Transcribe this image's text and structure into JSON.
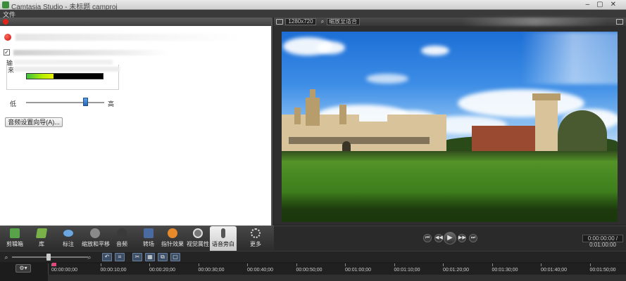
{
  "app": {
    "title": "Camtasia Studio - 未标题 camproj",
    "menu_file": "文件"
  },
  "voice_narration": {
    "input_label": "输",
    "source_label": "来",
    "low_label": "低",
    "high_label": "高",
    "checkbox_mark": "✓",
    "audio_setup_wizard": "音频设置向导(A)...",
    "input_level": 0.35,
    "volume_level": 0.76
  },
  "preview": {
    "resolution": "1280x720",
    "zoom": "缩放至适合",
    "zoom_icon": "magnifier-icon"
  },
  "player": {
    "timecode": "0:00:00:00 / 0:01:00:00"
  },
  "tasks": [
    {
      "label": "剪辑箱",
      "icon": "clip-bin-icon",
      "color": "#58a34a"
    },
    {
      "label": "库",
      "icon": "library-icon",
      "color": "#7ab24a"
    },
    {
      "label": "标注",
      "icon": "callout-icon",
      "color": "#6aa6e0"
    },
    {
      "label": "缩放和平移",
      "icon": "zoom-pan-icon",
      "color": "#8a8a8a"
    },
    {
      "label": "音频",
      "icon": "audio-icon",
      "color": "#3a3a3a"
    },
    {
      "label": "转场",
      "icon": "transitions-icon",
      "color": "#4a6aa0"
    },
    {
      "label": "指针效果",
      "icon": "cursor-effects-icon",
      "color": "#e88a2a"
    },
    {
      "label": "视觉属性",
      "icon": "visual-properties-icon",
      "color": "#777777"
    },
    {
      "label": "语音旁白",
      "icon": "microphone-icon",
      "color": "#555555"
    },
    {
      "label": "更多",
      "icon": "more-icon",
      "color": "#bbbbbb"
    }
  ],
  "timeline": {
    "gear_label": "⚙▾",
    "buttons": [
      "↶",
      "⌗",
      "✂",
      "▦",
      "⧉",
      "▢"
    ],
    "ruler_labels": [
      "00:00:00;00",
      "00:00:10;00",
      "00:00:20;00",
      "00:00:30;00",
      "00:00:40;00",
      "00:00:50;00",
      "00:01:00;00",
      "00:01:10;00",
      "00:01:20;00",
      "00:01:30;00",
      "00:01:40;00",
      "00:01:50;00"
    ]
  }
}
